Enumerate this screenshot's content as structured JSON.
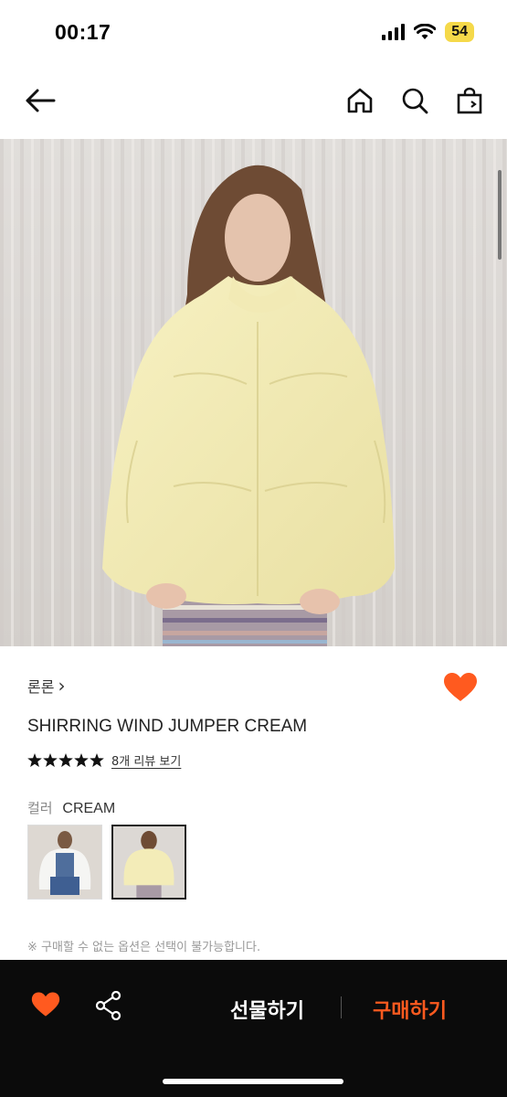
{
  "status_bar": {
    "time": "00:17",
    "battery": "54"
  },
  "nav": {
    "back_icon": "arrow-left-icon",
    "home_icon": "home-icon",
    "search_icon": "search-icon",
    "bag_icon": "shopping-bag-icon"
  },
  "product": {
    "brand": "론론",
    "brand_chevron": "›",
    "title": "SHIRRING WIND JUMPER CREAM",
    "rating": 5,
    "review_link": "8개 리뷰 보기",
    "option_label": "컬러",
    "option_value": "CREAM",
    "notice": "※ 구매할 수 없는 옵션은 선택이 불가능합니다.",
    "wished": true
  },
  "bottom_bar": {
    "gift_label": "선물하기",
    "buy_label": "구매하기"
  },
  "colors": {
    "accent": "#ff5a1f",
    "bottom_bar_bg": "#0b0b0b",
    "battery_bg": "#f5d94a"
  }
}
